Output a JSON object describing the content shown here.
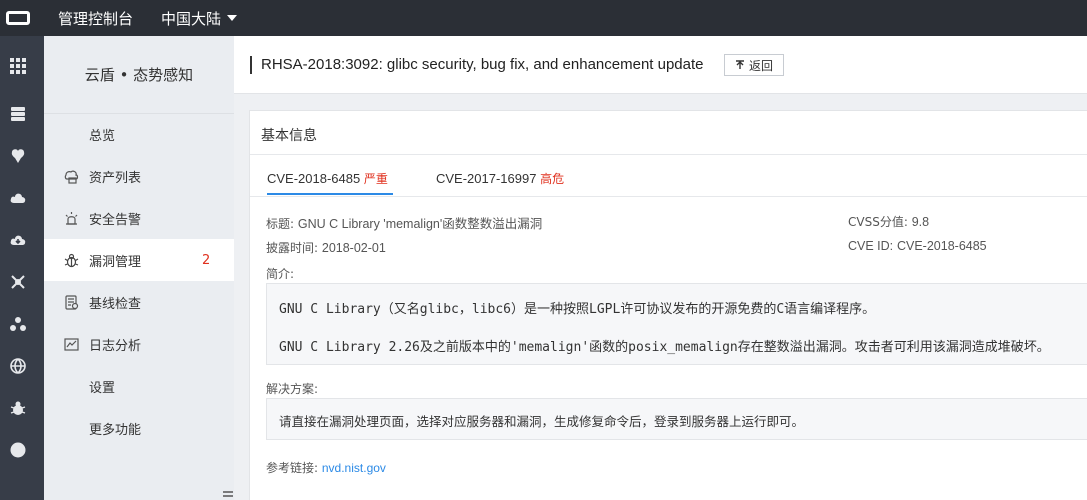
{
  "topbar": {
    "title": "管理控制台",
    "region": "中国大陆"
  },
  "rail": {
    "icons": [
      "apps-grid-icon",
      "server-icon",
      "shield-brain-icon",
      "cloud-icon",
      "cloud-download-icon",
      "network-icon",
      "cluster-icon",
      "globe-icon",
      "bug-icon",
      "circle-icon"
    ]
  },
  "subnav": {
    "heading": "云盾 • 态势感知",
    "items": [
      {
        "label": "总览",
        "icon": ""
      },
      {
        "label": "资产列表",
        "icon": "asset-list-icon"
      },
      {
        "label": "安全告警",
        "icon": "alarm-icon"
      },
      {
        "label": "漏洞管理",
        "icon": "bug-icon",
        "badge": "2",
        "active": true
      },
      {
        "label": "基线检查",
        "icon": "checklist-icon"
      },
      {
        "label": "日志分析",
        "icon": "log-icon"
      },
      {
        "label": "设置",
        "icon": ""
      },
      {
        "label": "更多功能",
        "icon": ""
      }
    ]
  },
  "page": {
    "title": "RHSA-2018:3092: glibc security, bug fix, and enhancement update",
    "back_label": "返回"
  },
  "card": {
    "title": "基本信息",
    "tabs": [
      {
        "cve": "CVE-2018-6485",
        "severity": "严重",
        "active": true
      },
      {
        "cve": "CVE-2017-16997",
        "severity": "高危",
        "active": false
      }
    ],
    "title_label": "标题:",
    "title_value": "GNU C Library 'memalign'函数整数溢出漏洞",
    "disclosed_label": "披露时间:",
    "disclosed_value": "2018-02-01",
    "cvss_label": "CVSS分值:",
    "cvss_value": "9.8",
    "cveid_label": "CVE ID:",
    "cveid_value": "CVE-2018-6485",
    "intro_label": "简介:",
    "intro_lines": [
      "GNU C Library（又名glibc，libc6）是一种按照LGPL许可协议发布的开源免费的C语言编译程序。",
      "GNU C Library 2.26及之前版本中的'memalign'函数的posix_memalign存在整数溢出漏洞。攻击者可利用该漏洞造成堆破坏。"
    ],
    "solution_label": "解决方案:",
    "solution_text": "请直接在漏洞处理页面，选择对应服务器和漏洞，生成修复命令后，登录到服务器上运行即可。",
    "ref_label": "参考链接:",
    "ref_link": "nvd.nist.gov"
  },
  "colors": {
    "topbar": "#2b2f36",
    "rail": "#373d48",
    "accent": "#2c8ae6",
    "danger": "#e0301e"
  }
}
